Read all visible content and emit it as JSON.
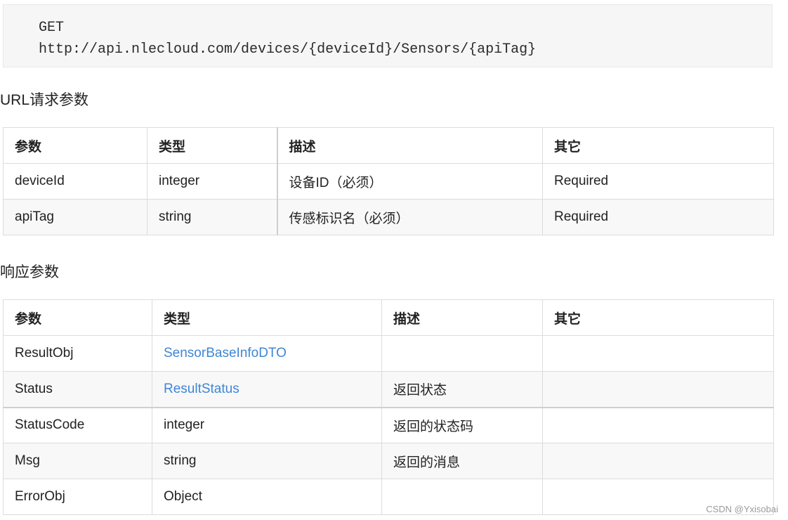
{
  "code": {
    "method": "GET",
    "url": "http://api.nlecloud.com/devices/{deviceId}/Sensors/{apiTag}"
  },
  "url_params": {
    "title": "URL请求参数",
    "headers": [
      "参数",
      "类型",
      "描述",
      "其它"
    ],
    "rows": [
      [
        "deviceId",
        "integer",
        "设备ID（必须）",
        "Required"
      ],
      [
        "apiTag",
        "string",
        "传感标识名（必须）",
        "Required"
      ]
    ]
  },
  "response_params": {
    "title": "响应参数",
    "headers": [
      "参数",
      "类型",
      "描述",
      "其它"
    ],
    "rows": [
      [
        "ResultObj",
        "SensorBaseInfoDTO",
        "",
        ""
      ],
      [
        "Status",
        "ResultStatus",
        "返回状态",
        ""
      ],
      [
        "StatusCode",
        "integer",
        "返回的状态码",
        ""
      ],
      [
        "Msg",
        "string",
        "返回的消息",
        ""
      ],
      [
        "ErrorObj",
        "Object",
        "",
        ""
      ]
    ]
  },
  "colors": {
    "link": "#3f86d4",
    "code_bg": "#f6f6f7"
  },
  "watermark": "CSDN @Yxisobai"
}
